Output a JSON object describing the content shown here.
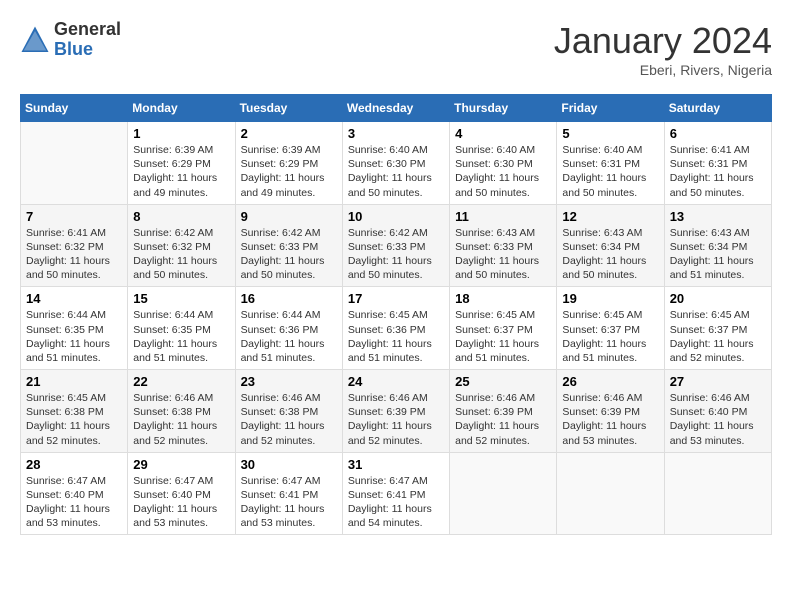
{
  "header": {
    "logo_general": "General",
    "logo_blue": "Blue",
    "month_title": "January 2024",
    "location": "Eberi, Rivers, Nigeria"
  },
  "weekdays": [
    "Sunday",
    "Monday",
    "Tuesday",
    "Wednesday",
    "Thursday",
    "Friday",
    "Saturday"
  ],
  "weeks": [
    [
      {
        "day": "",
        "sunrise": "",
        "sunset": "",
        "daylight": ""
      },
      {
        "day": "1",
        "sunrise": "Sunrise: 6:39 AM",
        "sunset": "Sunset: 6:29 PM",
        "daylight": "Daylight: 11 hours and 49 minutes."
      },
      {
        "day": "2",
        "sunrise": "Sunrise: 6:39 AM",
        "sunset": "Sunset: 6:29 PM",
        "daylight": "Daylight: 11 hours and 49 minutes."
      },
      {
        "day": "3",
        "sunrise": "Sunrise: 6:40 AM",
        "sunset": "Sunset: 6:30 PM",
        "daylight": "Daylight: 11 hours and 50 minutes."
      },
      {
        "day": "4",
        "sunrise": "Sunrise: 6:40 AM",
        "sunset": "Sunset: 6:30 PM",
        "daylight": "Daylight: 11 hours and 50 minutes."
      },
      {
        "day": "5",
        "sunrise": "Sunrise: 6:40 AM",
        "sunset": "Sunset: 6:31 PM",
        "daylight": "Daylight: 11 hours and 50 minutes."
      },
      {
        "day": "6",
        "sunrise": "Sunrise: 6:41 AM",
        "sunset": "Sunset: 6:31 PM",
        "daylight": "Daylight: 11 hours and 50 minutes."
      }
    ],
    [
      {
        "day": "7",
        "sunrise": "Sunrise: 6:41 AM",
        "sunset": "Sunset: 6:32 PM",
        "daylight": "Daylight: 11 hours and 50 minutes."
      },
      {
        "day": "8",
        "sunrise": "Sunrise: 6:42 AM",
        "sunset": "Sunset: 6:32 PM",
        "daylight": "Daylight: 11 hours and 50 minutes."
      },
      {
        "day": "9",
        "sunrise": "Sunrise: 6:42 AM",
        "sunset": "Sunset: 6:33 PM",
        "daylight": "Daylight: 11 hours and 50 minutes."
      },
      {
        "day": "10",
        "sunrise": "Sunrise: 6:42 AM",
        "sunset": "Sunset: 6:33 PM",
        "daylight": "Daylight: 11 hours and 50 minutes."
      },
      {
        "day": "11",
        "sunrise": "Sunrise: 6:43 AM",
        "sunset": "Sunset: 6:33 PM",
        "daylight": "Daylight: 11 hours and 50 minutes."
      },
      {
        "day": "12",
        "sunrise": "Sunrise: 6:43 AM",
        "sunset": "Sunset: 6:34 PM",
        "daylight": "Daylight: 11 hours and 50 minutes."
      },
      {
        "day": "13",
        "sunrise": "Sunrise: 6:43 AM",
        "sunset": "Sunset: 6:34 PM",
        "daylight": "Daylight: 11 hours and 51 minutes."
      }
    ],
    [
      {
        "day": "14",
        "sunrise": "Sunrise: 6:44 AM",
        "sunset": "Sunset: 6:35 PM",
        "daylight": "Daylight: 11 hours and 51 minutes."
      },
      {
        "day": "15",
        "sunrise": "Sunrise: 6:44 AM",
        "sunset": "Sunset: 6:35 PM",
        "daylight": "Daylight: 11 hours and 51 minutes."
      },
      {
        "day": "16",
        "sunrise": "Sunrise: 6:44 AM",
        "sunset": "Sunset: 6:36 PM",
        "daylight": "Daylight: 11 hours and 51 minutes."
      },
      {
        "day": "17",
        "sunrise": "Sunrise: 6:45 AM",
        "sunset": "Sunset: 6:36 PM",
        "daylight": "Daylight: 11 hours and 51 minutes."
      },
      {
        "day": "18",
        "sunrise": "Sunrise: 6:45 AM",
        "sunset": "Sunset: 6:37 PM",
        "daylight": "Daylight: 11 hours and 51 minutes."
      },
      {
        "day": "19",
        "sunrise": "Sunrise: 6:45 AM",
        "sunset": "Sunset: 6:37 PM",
        "daylight": "Daylight: 11 hours and 51 minutes."
      },
      {
        "day": "20",
        "sunrise": "Sunrise: 6:45 AM",
        "sunset": "Sunset: 6:37 PM",
        "daylight": "Daylight: 11 hours and 52 minutes."
      }
    ],
    [
      {
        "day": "21",
        "sunrise": "Sunrise: 6:45 AM",
        "sunset": "Sunset: 6:38 PM",
        "daylight": "Daylight: 11 hours and 52 minutes."
      },
      {
        "day": "22",
        "sunrise": "Sunrise: 6:46 AM",
        "sunset": "Sunset: 6:38 PM",
        "daylight": "Daylight: 11 hours and 52 minutes."
      },
      {
        "day": "23",
        "sunrise": "Sunrise: 6:46 AM",
        "sunset": "Sunset: 6:38 PM",
        "daylight": "Daylight: 11 hours and 52 minutes."
      },
      {
        "day": "24",
        "sunrise": "Sunrise: 6:46 AM",
        "sunset": "Sunset: 6:39 PM",
        "daylight": "Daylight: 11 hours and 52 minutes."
      },
      {
        "day": "25",
        "sunrise": "Sunrise: 6:46 AM",
        "sunset": "Sunset: 6:39 PM",
        "daylight": "Daylight: 11 hours and 52 minutes."
      },
      {
        "day": "26",
        "sunrise": "Sunrise: 6:46 AM",
        "sunset": "Sunset: 6:39 PM",
        "daylight": "Daylight: 11 hours and 53 minutes."
      },
      {
        "day": "27",
        "sunrise": "Sunrise: 6:46 AM",
        "sunset": "Sunset: 6:40 PM",
        "daylight": "Daylight: 11 hours and 53 minutes."
      }
    ],
    [
      {
        "day": "28",
        "sunrise": "Sunrise: 6:47 AM",
        "sunset": "Sunset: 6:40 PM",
        "daylight": "Daylight: 11 hours and 53 minutes."
      },
      {
        "day": "29",
        "sunrise": "Sunrise: 6:47 AM",
        "sunset": "Sunset: 6:40 PM",
        "daylight": "Daylight: 11 hours and 53 minutes."
      },
      {
        "day": "30",
        "sunrise": "Sunrise: 6:47 AM",
        "sunset": "Sunset: 6:41 PM",
        "daylight": "Daylight: 11 hours and 53 minutes."
      },
      {
        "day": "31",
        "sunrise": "Sunrise: 6:47 AM",
        "sunset": "Sunset: 6:41 PM",
        "daylight": "Daylight: 11 hours and 54 minutes."
      },
      {
        "day": "",
        "sunrise": "",
        "sunset": "",
        "daylight": ""
      },
      {
        "day": "",
        "sunrise": "",
        "sunset": "",
        "daylight": ""
      },
      {
        "day": "",
        "sunrise": "",
        "sunset": "",
        "daylight": ""
      }
    ]
  ]
}
